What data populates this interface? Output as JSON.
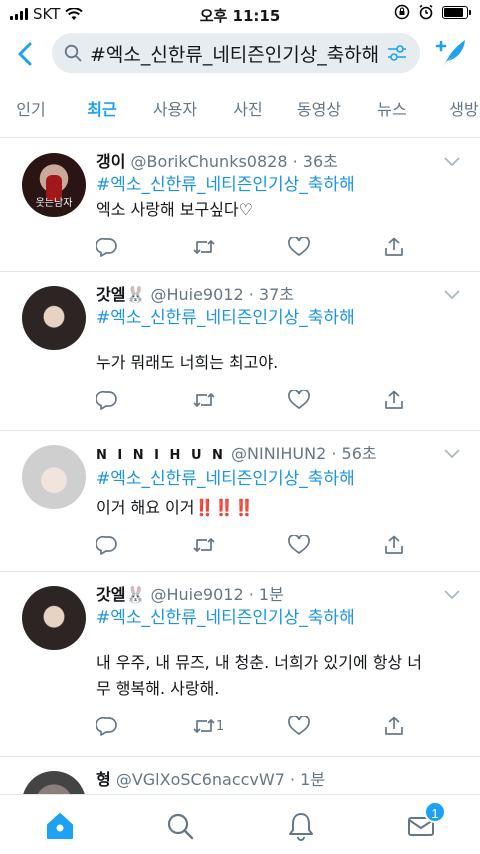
{
  "status_bar": {
    "carrier": "SKT",
    "time": "오후 11:15",
    "battery_level": 0.85
  },
  "search": {
    "query": "#엑소_신한류_네티즌인기상_축하해"
  },
  "tabs": [
    {
      "label": "인기"
    },
    {
      "label": "최근",
      "active": true
    },
    {
      "label": "사용자"
    },
    {
      "label": "사진"
    },
    {
      "label": "동영상"
    },
    {
      "label": "뉴스"
    },
    {
      "label": "생방"
    }
  ],
  "tweets": [
    {
      "name": "갱이",
      "handle": "@BorikChunks0828",
      "time": "36초",
      "hashtag": "#엑소_신한류_네티즌인기상_축하해",
      "text": "엑소 사랑해 보구싶다♡",
      "avatar_caption": "웃는남자",
      "retweets": "",
      "avatar_color": "#4a2a2a"
    },
    {
      "name": "갓엘🐰",
      "handle": "@Huie9012",
      "time": "37초",
      "hashtag": "#엑소_신한류_네티즌인기상_축하해",
      "text": "누가 뭐래도 너희는 최고야.",
      "retweets": "",
      "avatar_color": "#3b3535"
    },
    {
      "name": "N I N I  H U N",
      "handle": "@NINIHUN2",
      "time": "56초",
      "hashtag": "#엑소_신한류_네티즌인기상_축하해",
      "text": "이거 해요 이거‼️‼️‼️",
      "retweets": "",
      "avatar_color": "#d9d9d9"
    },
    {
      "name": "갓엘🐰",
      "handle": "@Huie9012",
      "time": "1분",
      "hashtag": "#엑소_신한류_네티즌인기상_축하해",
      "text": "내 우주, 내 뮤즈, 내 청춘. 너희가 있기에 항상 너무 행복해. 사랑해.",
      "retweets": "1",
      "avatar_color": "#3b3535"
    },
    {
      "name": "형",
      "handle": "@VGlXoSC6naccvW7",
      "time": "1분",
      "hashtag": "",
      "text": "",
      "retweets": "",
      "avatar_color": "#555"
    }
  ],
  "bottom_nav": {
    "messages_badge": "1"
  },
  "colors": {
    "accent": "#1da1f2",
    "link": "#1b95e0",
    "muted": "#657786",
    "divider": "#e1e8ed"
  }
}
